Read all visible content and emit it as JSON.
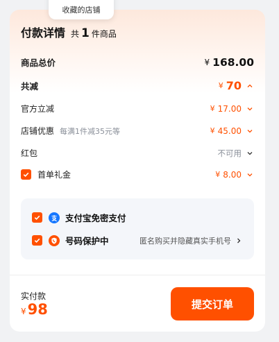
{
  "tooltip": {
    "text": "收藏的店铺"
  },
  "header": {
    "title": "付款详情",
    "gong": "共",
    "count": "1",
    "unit": "件商品"
  },
  "summary": {
    "goods_total_label": "商品总价",
    "currency": "¥",
    "goods_total_value": "168.00",
    "discount_label": "共减",
    "discount_value": "70"
  },
  "discounts": [
    {
      "label": "官方立减",
      "value": "17.00"
    },
    {
      "label": "店铺优惠",
      "note": "每满1件减35元等",
      "value": "45.00"
    },
    {
      "label": "红包",
      "value": "不可用"
    },
    {
      "label": "首单礼金",
      "value": "8.00",
      "checked": true
    }
  ],
  "options": [
    {
      "label": "支付宝免密支付",
      "checked": true
    },
    {
      "label": "号码保护中",
      "note": "匿名购买并隐藏真实手机号",
      "checked": true
    }
  ],
  "footer": {
    "pay_label": "实付款",
    "currency": "¥",
    "pay_value": "98",
    "submit_label": "提交订单"
  },
  "colors": {
    "accent": "#ff5000",
    "alipay": "#1677ff"
  }
}
